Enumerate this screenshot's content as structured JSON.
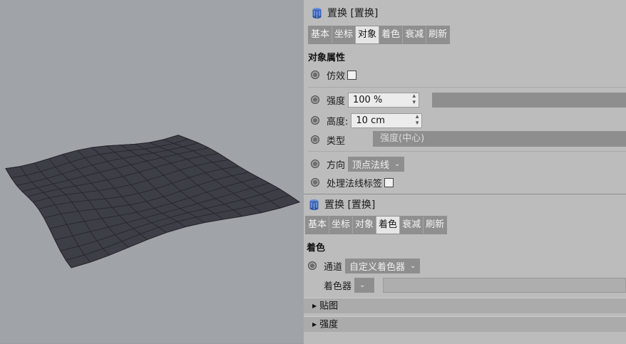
{
  "panel1": {
    "title": "置换 [置换]",
    "tabs": [
      "基本",
      "坐标",
      "对象",
      "着色",
      "衰减",
      "刷新"
    ],
    "active_tab": 2,
    "section": "对象属性",
    "imitate_label": "仿效",
    "strength_label": "强度",
    "strength_value": "100 %",
    "height_label": "高度:",
    "height_value": "10 cm",
    "type_label": "类型",
    "type_value": "强度(中心)",
    "direction_label": "方向",
    "direction_value": "顶点法线",
    "normal_tag_label": "处理法线标签"
  },
  "panel2": {
    "title": "置换 [置换]",
    "tabs": [
      "基本",
      "坐标",
      "对象",
      "着色",
      "衰减",
      "刷新"
    ],
    "active_tab": 3,
    "section": "着色",
    "channel_label": "通道",
    "channel_value": "自定义着色器",
    "shader_label": "着色器",
    "fold1": "贴图",
    "fold2": "强度"
  },
  "icons": {
    "object": "displacer-cylinder-icon",
    "stepper": "stepper-arrows-icon",
    "dropdown": "chevron-down-icon",
    "fold": "triangle-right-icon"
  },
  "colors": {
    "panel": "#bcbcbc",
    "tab": "#8f8f8f",
    "active_tab": "#e6e6e6",
    "viewport": "#a0a3a8",
    "mesh": "#3d3f46"
  }
}
